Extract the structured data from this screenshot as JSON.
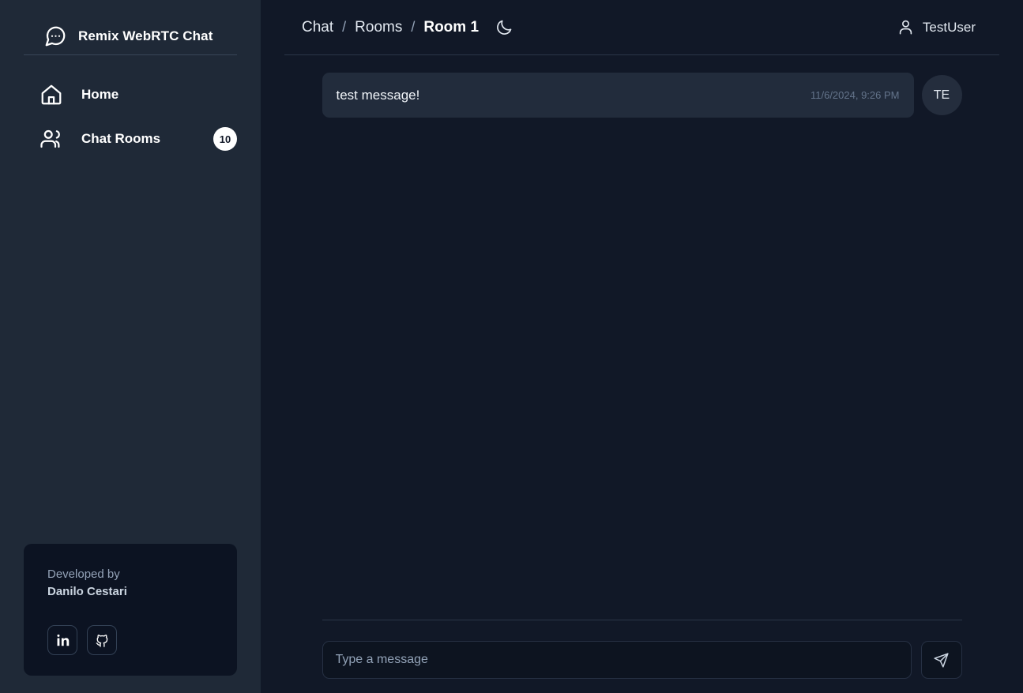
{
  "theme": {
    "sidebar_bg": "#1f2937",
    "main_bg": "#111827",
    "bubble_bg": "#222c3c",
    "input_bg": "#0d1420",
    "card_bg": "#0c1322",
    "text_primary": "#ffffff",
    "text_muted": "#94a3b8",
    "badge_bg": "#ffffff"
  },
  "sidebar": {
    "brand": {
      "title": "Remix WebRTC Chat",
      "icon": "chat-bubble-dots-icon"
    },
    "items": [
      {
        "label": "Home",
        "icon": "home-icon",
        "badge": ""
      },
      {
        "label": "Chat Rooms",
        "icon": "users-icon",
        "badge": "10"
      }
    ],
    "footer_card": {
      "subtitle": "Developed by",
      "name": "Danilo Cestari",
      "links": [
        {
          "icon": "linkedin-icon",
          "name": "LinkedIn"
        },
        {
          "icon": "github-icon",
          "name": "GitHub"
        }
      ]
    }
  },
  "header": {
    "breadcrumbs": [
      {
        "label": "Chat",
        "current": false
      },
      {
        "label": "Rooms",
        "current": false
      },
      {
        "label": "Room 1",
        "current": true
      }
    ],
    "separator": "/",
    "theme_toggle_icon": "moon-icon",
    "user": {
      "name": "TestUser",
      "icon": "user-icon"
    }
  },
  "chat": {
    "messages": [
      {
        "text": "test message!",
        "timestamp": "11/6/2024, 9:26 PM",
        "avatar_initials": "TE"
      }
    ],
    "composer": {
      "placeholder": "Type a message",
      "value": "",
      "send_icon": "send-paper-plane-icon"
    }
  }
}
